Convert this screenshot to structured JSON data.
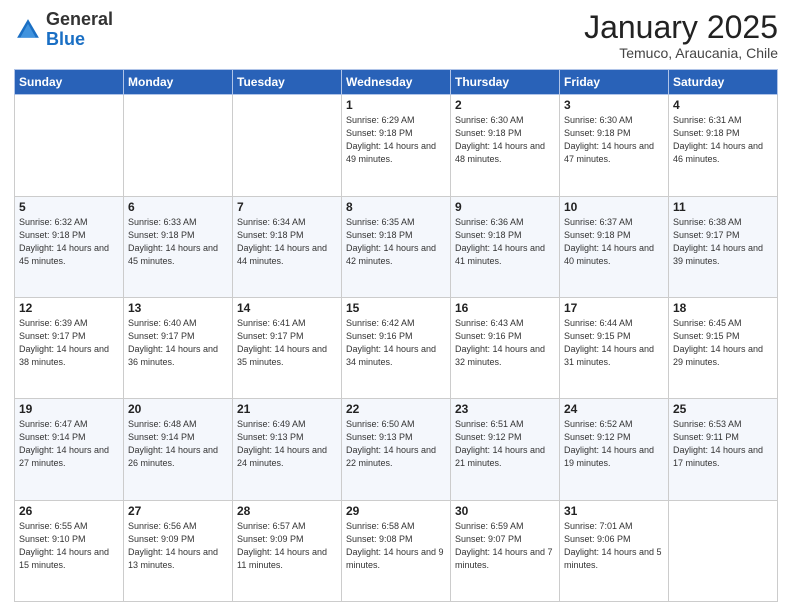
{
  "header": {
    "logo_general": "General",
    "logo_blue": "Blue",
    "month_title": "January 2025",
    "location": "Temuco, Araucania, Chile"
  },
  "days_of_week": [
    "Sunday",
    "Monday",
    "Tuesday",
    "Wednesday",
    "Thursday",
    "Friday",
    "Saturday"
  ],
  "weeks": [
    [
      {
        "day": "",
        "info": ""
      },
      {
        "day": "",
        "info": ""
      },
      {
        "day": "",
        "info": ""
      },
      {
        "day": "1",
        "info": "Sunrise: 6:29 AM\nSunset: 9:18 PM\nDaylight: 14 hours\nand 49 minutes."
      },
      {
        "day": "2",
        "info": "Sunrise: 6:30 AM\nSunset: 9:18 PM\nDaylight: 14 hours\nand 48 minutes."
      },
      {
        "day": "3",
        "info": "Sunrise: 6:30 AM\nSunset: 9:18 PM\nDaylight: 14 hours\nand 47 minutes."
      },
      {
        "day": "4",
        "info": "Sunrise: 6:31 AM\nSunset: 9:18 PM\nDaylight: 14 hours\nand 46 minutes."
      }
    ],
    [
      {
        "day": "5",
        "info": "Sunrise: 6:32 AM\nSunset: 9:18 PM\nDaylight: 14 hours\nand 45 minutes."
      },
      {
        "day": "6",
        "info": "Sunrise: 6:33 AM\nSunset: 9:18 PM\nDaylight: 14 hours\nand 45 minutes."
      },
      {
        "day": "7",
        "info": "Sunrise: 6:34 AM\nSunset: 9:18 PM\nDaylight: 14 hours\nand 44 minutes."
      },
      {
        "day": "8",
        "info": "Sunrise: 6:35 AM\nSunset: 9:18 PM\nDaylight: 14 hours\nand 42 minutes."
      },
      {
        "day": "9",
        "info": "Sunrise: 6:36 AM\nSunset: 9:18 PM\nDaylight: 14 hours\nand 41 minutes."
      },
      {
        "day": "10",
        "info": "Sunrise: 6:37 AM\nSunset: 9:18 PM\nDaylight: 14 hours\nand 40 minutes."
      },
      {
        "day": "11",
        "info": "Sunrise: 6:38 AM\nSunset: 9:17 PM\nDaylight: 14 hours\nand 39 minutes."
      }
    ],
    [
      {
        "day": "12",
        "info": "Sunrise: 6:39 AM\nSunset: 9:17 PM\nDaylight: 14 hours\nand 38 minutes."
      },
      {
        "day": "13",
        "info": "Sunrise: 6:40 AM\nSunset: 9:17 PM\nDaylight: 14 hours\nand 36 minutes."
      },
      {
        "day": "14",
        "info": "Sunrise: 6:41 AM\nSunset: 9:17 PM\nDaylight: 14 hours\nand 35 minutes."
      },
      {
        "day": "15",
        "info": "Sunrise: 6:42 AM\nSunset: 9:16 PM\nDaylight: 14 hours\nand 34 minutes."
      },
      {
        "day": "16",
        "info": "Sunrise: 6:43 AM\nSunset: 9:16 PM\nDaylight: 14 hours\nand 32 minutes."
      },
      {
        "day": "17",
        "info": "Sunrise: 6:44 AM\nSunset: 9:15 PM\nDaylight: 14 hours\nand 31 minutes."
      },
      {
        "day": "18",
        "info": "Sunrise: 6:45 AM\nSunset: 9:15 PM\nDaylight: 14 hours\nand 29 minutes."
      }
    ],
    [
      {
        "day": "19",
        "info": "Sunrise: 6:47 AM\nSunset: 9:14 PM\nDaylight: 14 hours\nand 27 minutes."
      },
      {
        "day": "20",
        "info": "Sunrise: 6:48 AM\nSunset: 9:14 PM\nDaylight: 14 hours\nand 26 minutes."
      },
      {
        "day": "21",
        "info": "Sunrise: 6:49 AM\nSunset: 9:13 PM\nDaylight: 14 hours\nand 24 minutes."
      },
      {
        "day": "22",
        "info": "Sunrise: 6:50 AM\nSunset: 9:13 PM\nDaylight: 14 hours\nand 22 minutes."
      },
      {
        "day": "23",
        "info": "Sunrise: 6:51 AM\nSunset: 9:12 PM\nDaylight: 14 hours\nand 21 minutes."
      },
      {
        "day": "24",
        "info": "Sunrise: 6:52 AM\nSunset: 9:12 PM\nDaylight: 14 hours\nand 19 minutes."
      },
      {
        "day": "25",
        "info": "Sunrise: 6:53 AM\nSunset: 9:11 PM\nDaylight: 14 hours\nand 17 minutes."
      }
    ],
    [
      {
        "day": "26",
        "info": "Sunrise: 6:55 AM\nSunset: 9:10 PM\nDaylight: 14 hours\nand 15 minutes."
      },
      {
        "day": "27",
        "info": "Sunrise: 6:56 AM\nSunset: 9:09 PM\nDaylight: 14 hours\nand 13 minutes."
      },
      {
        "day": "28",
        "info": "Sunrise: 6:57 AM\nSunset: 9:09 PM\nDaylight: 14 hours\nand 11 minutes."
      },
      {
        "day": "29",
        "info": "Sunrise: 6:58 AM\nSunset: 9:08 PM\nDaylight: 14 hours\nand 9 minutes."
      },
      {
        "day": "30",
        "info": "Sunrise: 6:59 AM\nSunset: 9:07 PM\nDaylight: 14 hours\nand 7 minutes."
      },
      {
        "day": "31",
        "info": "Sunrise: 7:01 AM\nSunset: 9:06 PM\nDaylight: 14 hours\nand 5 minutes."
      },
      {
        "day": "",
        "info": ""
      }
    ]
  ]
}
